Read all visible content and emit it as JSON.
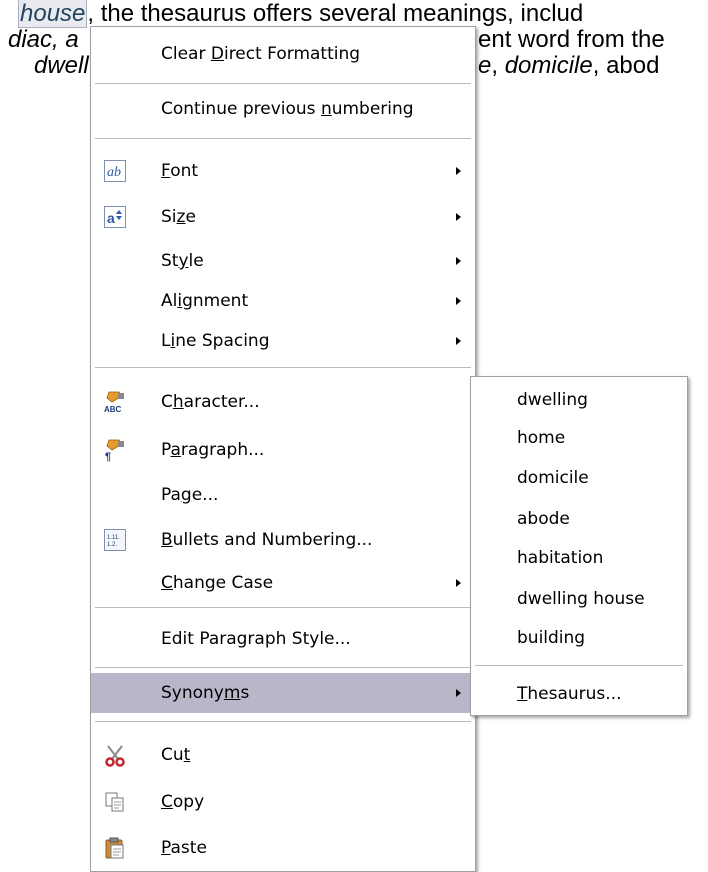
{
  "document": {
    "selected_word": "house",
    "line1_rest": ", the thesaurus offers several meanings, includ",
    "line2_start": "diac, a",
    "line2_end": "ent word from the",
    "line3_start": "dwell",
    "line3_end_a": "e",
    "line3_end_b": ", ",
    "line3_domicile": "domicile",
    "line3_end_c": ", abod"
  },
  "menu": {
    "items": [
      {
        "label_pre": "Clear ",
        "label_u": "D",
        "label_post": "irect Formatting"
      },
      {
        "label_pre": "Continue previous ",
        "label_u": "n",
        "label_post": "umbering"
      },
      {
        "label_pre": "",
        "label_u": "F",
        "label_post": "ont",
        "icon": "font-icon",
        "submenu": true
      },
      {
        "label_pre": "Si",
        "label_u": "z",
        "label_post": "e",
        "icon": "size-icon",
        "submenu": true
      },
      {
        "label_pre": "St",
        "label_u": "y",
        "label_post": "le",
        "submenu": true
      },
      {
        "label_pre": "Al",
        "label_u": "i",
        "label_post": "gnment",
        "submenu": true
      },
      {
        "label_pre": "L",
        "label_u": "i",
        "label_post": "ne Spacing",
        "submenu": true
      },
      {
        "label_pre": "C",
        "label_u": "h",
        "label_post": "aracter...",
        "icon": "character-icon"
      },
      {
        "label_pre": "P",
        "label_u": "a",
        "label_post": "ragraph...",
        "icon": "paragraph-icon"
      },
      {
        "label_pre": "Pa",
        "label_u": "g",
        "label_post": "e..."
      },
      {
        "label_pre": "",
        "label_u": "B",
        "label_post": "ullets and Numbering...",
        "icon": "bullets-numbering-icon"
      },
      {
        "label_pre": "",
        "label_u": "C",
        "label_post": "hange Case",
        "submenu": true
      },
      {
        "label_pre": "Edit Paragraph Style...",
        "label_u": "",
        "label_post": ""
      },
      {
        "label_pre": "Synony",
        "label_u": "m",
        "label_post": "s",
        "submenu": true,
        "highlighted": true
      },
      {
        "label_pre": "Cu",
        "label_u": "t",
        "label_post": "",
        "icon": "cut-icon"
      },
      {
        "label_pre": "",
        "label_u": "C",
        "label_post": "opy",
        "icon": "copy-icon"
      },
      {
        "label_pre": "",
        "label_u": "P",
        "label_post": "aste",
        "icon": "paste-icon"
      }
    ],
    "icon_texts": {
      "font": "ab",
      "size": "a",
      "character": "ABC",
      "paragraph": "¶",
      "bullets": "1.2."
    }
  },
  "synonyms_submenu": {
    "items": [
      "dwelling",
      "home",
      "domicile",
      "abode",
      "habitation",
      "dwelling house",
      "building"
    ],
    "thesaurus_u": "T",
    "thesaurus_post": "hesaurus..."
  },
  "colors": {
    "highlight": "#b9b6c9",
    "menu_border": "#a0a0a0",
    "icon_blue": "#2a5aa8",
    "cut_red": "#c0262c",
    "paste_orange": "#b5752a"
  }
}
